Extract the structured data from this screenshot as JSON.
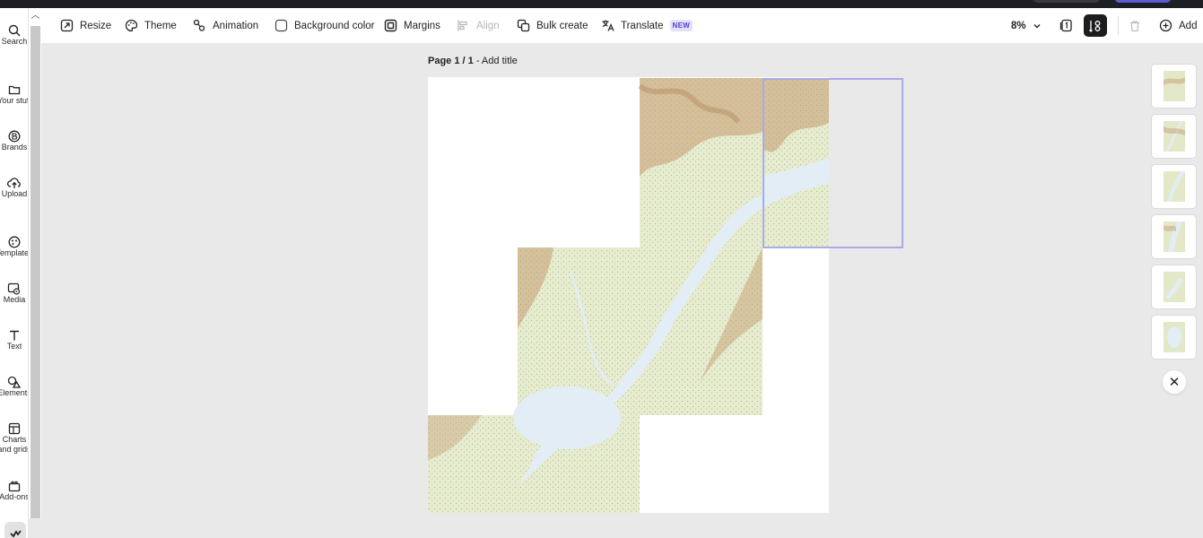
{
  "toolbar": {
    "resize": "Resize",
    "theme": "Theme",
    "animation": "Animation",
    "background_color": "Background color",
    "margins": "Margins",
    "align": "Align",
    "bulk_create": "Bulk create",
    "translate": "Translate",
    "translate_badge": "NEW",
    "zoom": "8%",
    "add": "Add"
  },
  "sidebar": {
    "items": [
      {
        "label": "Search",
        "icon": "search-icon"
      },
      {
        "label": "Your stuff",
        "icon": "folder-icon"
      },
      {
        "label": "Brands",
        "icon": "brand-icon"
      },
      {
        "label": "Upload",
        "icon": "upload-icon"
      },
      {
        "label": "Templates",
        "icon": "templates-icon"
      },
      {
        "label": "Media",
        "icon": "media-icon"
      },
      {
        "label": "Text",
        "icon": "text-icon"
      },
      {
        "label": "Elements",
        "icon": "elements-icon"
      },
      {
        "label": "Charts and grids",
        "icon": "chart-grid-icon"
      },
      {
        "label": "Add-ons",
        "icon": "addons-icon"
      }
    ]
  },
  "canvas": {
    "page_label": "Page 1 / 1",
    "add_title": " - Add title"
  },
  "colors": {
    "accent": "#5b5bd6",
    "selection": "#a9aae8",
    "map_water": "#e3edf6",
    "map_land": "#e2e8c8",
    "map_relief": "#b98a5e"
  }
}
